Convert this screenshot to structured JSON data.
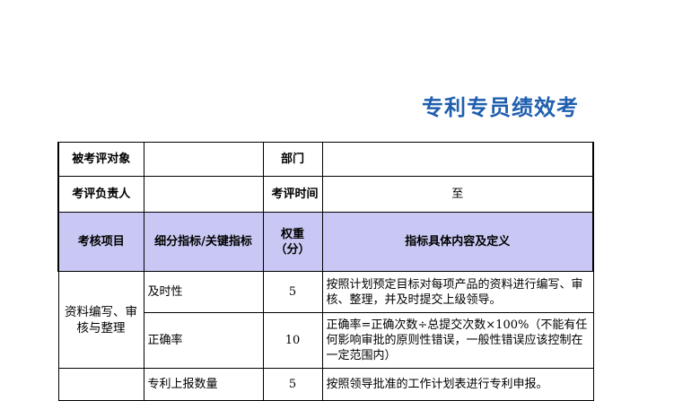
{
  "title": "专利专员绩效考",
  "row1": {
    "label_target": "被考评对象",
    "target_value": "",
    "label_dept": "部门",
    "dept_value": ""
  },
  "row2": {
    "label_owner": "考评负责人",
    "owner_value": "",
    "label_time": "考评时间",
    "time_value": "至"
  },
  "header": {
    "item": "考核项目",
    "indicator": "细分指标/关键指标",
    "weight": "权重\n（分）",
    "definition": "指标具体内容及定义"
  },
  "category": "资料编写、审核与整理",
  "rows": [
    {
      "indicator": "及时性",
      "weight": "5",
      "definition": "按照计划预定目标对每项产品的资料进行编写、审核、整理，并及时提交上级领导。"
    },
    {
      "indicator": "正确率",
      "weight": "10",
      "definition": "正确率=正确次数÷总提交次数×100%（不能有任何影响审批的原则性错误，一般性错误应该控制在一定范围内）"
    },
    {
      "indicator": "专利上报数量",
      "weight": "5",
      "definition": "按照领导批准的工作计划表进行专利申报。"
    }
  ]
}
